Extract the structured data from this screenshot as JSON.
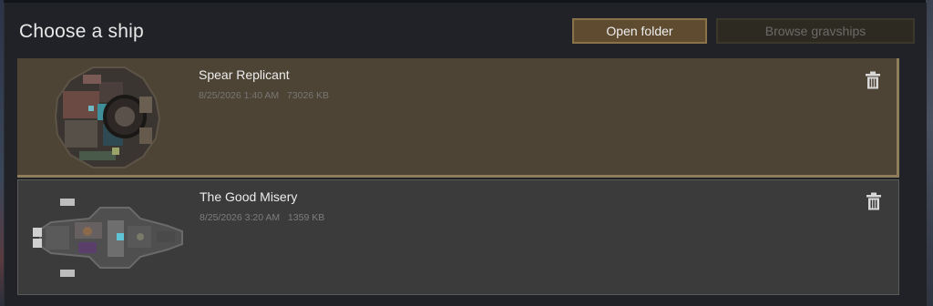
{
  "dialog": {
    "title": "Choose a ship",
    "open_folder_label": "Open folder",
    "browse_label": "Browse gravships"
  },
  "ships": [
    {
      "name": "Spear Replicant",
      "date": "8/25/2026 1:40 AM",
      "size": "73026 KB",
      "selected": true,
      "delete_icon": "trash-icon"
    },
    {
      "name": "The Good Misery",
      "date": "8/25/2026 3:20 AM",
      "size": "1359 KB",
      "selected": false,
      "delete_icon": "trash-icon"
    }
  ],
  "colors": {
    "selected_row": "#4d4436",
    "normal_row": "#3b3b3c",
    "accent_button": "#5e4b30",
    "disabled_button": "#2d2a22"
  }
}
